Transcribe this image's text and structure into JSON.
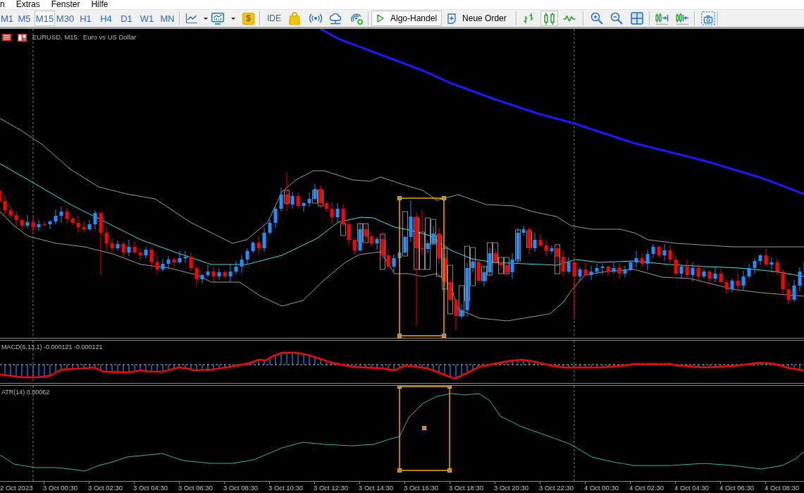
{
  "menu_bar": {
    "items": [
      {
        "label": "n"
      },
      {
        "label": "Extras"
      },
      {
        "label": "Fenster"
      },
      {
        "label": "Hilfe"
      }
    ]
  },
  "toolbar": {
    "timeframes": [
      {
        "label": "M1",
        "selected": false
      },
      {
        "label": "M5",
        "selected": false
      },
      {
        "label": "M15",
        "selected": true
      },
      {
        "label": "M30",
        "selected": false
      },
      {
        "label": "H1",
        "selected": false
      },
      {
        "label": "H4",
        "selected": false
      },
      {
        "label": "D1",
        "selected": false
      },
      {
        "label": "W1",
        "selected": false
      },
      {
        "label": "MN",
        "selected": false
      }
    ],
    "market_button": {
      "symbol": "$"
    },
    "ide_button": {
      "label": "IDE"
    },
    "algo_trading_button": {
      "label": "Algo-Handel",
      "active": true
    },
    "new_order_button": {
      "label": "Neue Order"
    },
    "chart_types": [
      {
        "kind": "bars",
        "selected": false
      },
      {
        "kind": "candles",
        "selected": true
      },
      {
        "kind": "line",
        "selected": false
      }
    ]
  },
  "chart": {
    "title": "EURUSD, M15:  Euro vs US Dollar",
    "indicator_windows": [
      {
        "kind": "macd",
        "label": "MACD(6,13,1) -0.000121 -0.000121"
      },
      {
        "kind": "atr",
        "label": "ATR(14) 0.00062"
      }
    ],
    "time_axis": {
      "labels": [
        "2 Oct 2023",
        "3 Oct 00:30",
        "3 Oct 02:30",
        "3 Oct 04:30",
        "3 Oct 06:30",
        "3 Oct 08:30",
        "3 Oct 10:30",
        "3 Oct 12:30",
        "3 Oct 14:30",
        "3 Oct 16:30",
        "3 Oct 18:30",
        "3 Oct 20:30",
        "3 Oct 22:30",
        "4 Oct 00:30",
        "4 Oct 02:30",
        "4 Oct 04:30",
        "4 Oct 06:30",
        "4 Oct 08:30"
      ]
    }
  }
}
